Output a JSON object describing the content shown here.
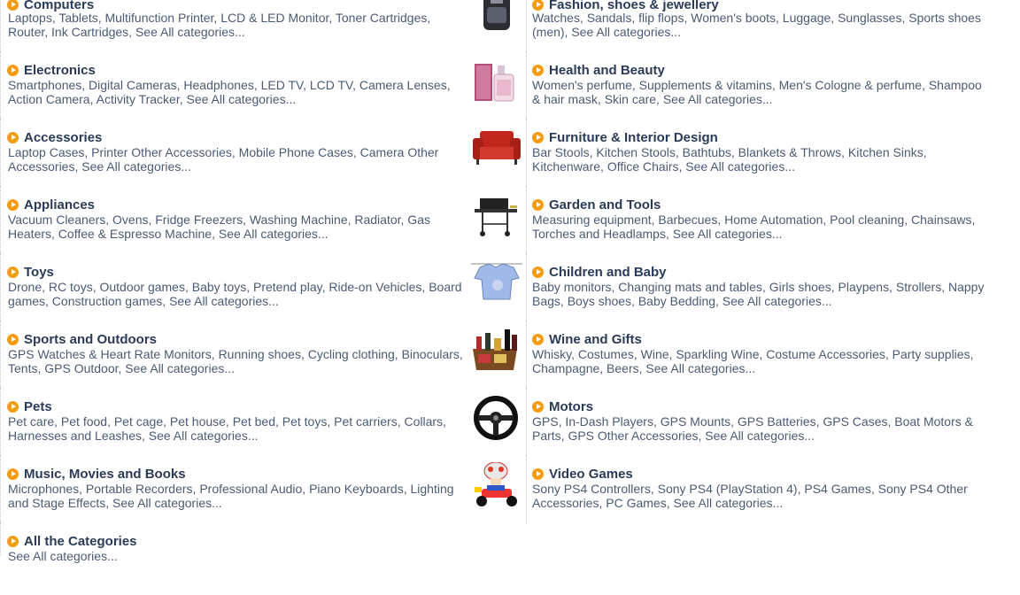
{
  "left": [
    {
      "title": "Computers",
      "subs": "Laptops, Tablets, Multifunction Printer, LCD & LED Monitor, Toner Cartridges, Router, Ink Cartridges, See All categories..."
    },
    {
      "title": "Electronics",
      "subs": "Smartphones, Digital Cameras, Headphones, LED TV, LCD TV, Camera Lenses, Action Camera, Activity Tracker, See All categories..."
    },
    {
      "title": "Accessories",
      "subs": "Laptop Cases, Printer Other Accessories, Mobile Phone Cases, Camera Other Accessories, See All categories..."
    },
    {
      "title": "Appliances",
      "subs": "Vacuum Cleaners, Ovens, Fridge Freezers, Washing Machine, Radiator, Gas Heaters, Coffee & Espresso Machine, See All categories..."
    },
    {
      "title": "Toys",
      "subs": "Drone, RC toys, Outdoor games, Baby toys, Pretend play, Ride-on Vehicles, Board games, Construction games, See All categories..."
    },
    {
      "title": "Sports and Outdoors",
      "subs": "GPS Watches & Heart Rate Monitors, Running shoes, Cycling clothing, Binoculars, Tents, GPS Outdoor, See All categories..."
    },
    {
      "title": "Pets",
      "subs": "Pet care, Pet food, Pet cage, Pet house, Pet bed, Pet toys, Pet carriers, Collars, Harnesses and Leashes, See All categories..."
    },
    {
      "title": "Music, Movies and Books",
      "subs": "Microphones, Portable Recorders, Professional Audio, Piano Keyboards, Lighting and Stage Effects, See All categories..."
    },
    {
      "title": "All the Categories",
      "subs": "See All categories..."
    }
  ],
  "right": [
    {
      "title": "Fashion, shoes & jewellery",
      "subs": "Watches, Sandals, flip flops, Women's boots, Luggage, Sunglasses, Sports shoes (men), See All categories...",
      "image": "backpack-image"
    },
    {
      "title": "Health and Beauty",
      "subs": "Women's perfume, Supplements & vitamins, Men's Cologne & perfume, Shampoo & hair mask, Skin care, See All categories...",
      "image": "perfume-image"
    },
    {
      "title": "Furniture & Interior Design",
      "subs": "Bar Stools, Kitchen Stools, Bathtubs, Blankets & Throws, Kitchen Sinks, Kitchenware, Office Chairs, See All categories...",
      "image": "armchair-image"
    },
    {
      "title": "Garden and Tools",
      "subs": "Measuring equipment, Barbecues, Home Automation, Pool cleaning, Chainsaws, Torches and Headlamps, See All categories...",
      "image": "barbecue-image"
    },
    {
      "title": "Children and Baby",
      "subs": "Baby monitors, Changing mats and tables, Girls shoes, Playpens, Strollers, Nappy Bags, Boys shoes, Baby Bedding, See All categories...",
      "image": "baby-tshirt-image"
    },
    {
      "title": "Wine and Gifts",
      "subs": "Whisky, Costumes, Wine, Sparkling Wine, Costume Accessories, Party supplies, Champagne, Beers, See All categories...",
      "image": "gift-basket-image"
    },
    {
      "title": "Motors",
      "subs": "GPS, In-Dash Players, GPS Mounts, GPS Batteries, GPS Cases, Boat Motors & Parts, GPS Other Accessories, See All categories...",
      "image": "steering-wheel-image"
    },
    {
      "title": "Video Games",
      "subs": "Sony PS4 Controllers, Sony PS4 (PlayStation 4), PS4 Games, Sony PS4 Other Accessories, PC Games, See All categories...",
      "image": "kart-toad-image"
    }
  ],
  "colors": {
    "accent": "#f39c12",
    "title": "#2a3b57",
    "text": "#4b5a74"
  }
}
